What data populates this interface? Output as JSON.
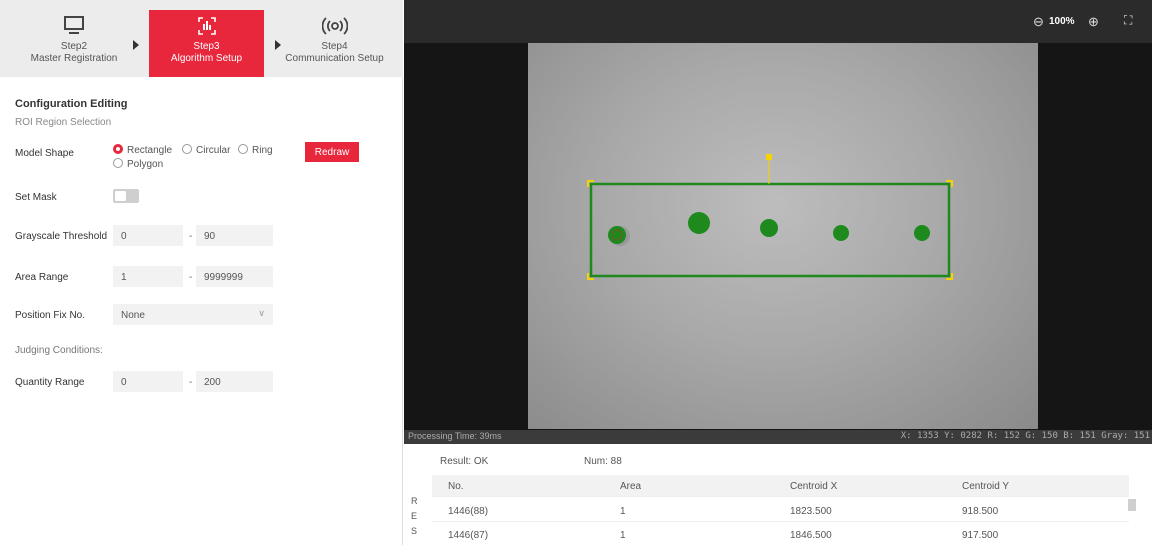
{
  "steps": [
    {
      "title": "Step2",
      "name": "Master Registration",
      "icon": "monitor-icon"
    },
    {
      "title": "Step3",
      "name": "Algorithm Setup",
      "icon": "algorithm-icon"
    },
    {
      "title": "Step4",
      "name": "Communication Setup",
      "icon": "broadcast-icon"
    }
  ],
  "config": {
    "title": "Configuration Editing",
    "roi_label": "ROI Region Selection",
    "model_shape_label": "Model Shape",
    "shapes": [
      "Rectangle",
      "Circular",
      "Ring",
      "Polygon"
    ],
    "selected_shape": "Rectangle",
    "redraw_label": "Redraw",
    "set_mask_label": "Set Mask",
    "set_mask_on": false,
    "grayscale_label": "Grayscale Threshold",
    "grayscale_min": "0",
    "grayscale_max": "90",
    "area_label": "Area Range",
    "area_min": "1",
    "area_max": "9999999",
    "position_fix_label": "Position Fix No.",
    "position_fix_value": "None",
    "judging_label": "Judging Conditions:",
    "quantity_label": "Quantity Range",
    "quantity_min": "0",
    "quantity_max": "200",
    "dash": "-"
  },
  "viewer": {
    "zoom_level": "100%",
    "processing_time": "Processing Time: 39ms",
    "coords": "X: 1353  Y: 0282  R: 152  G: 150  B: 151  Gray: 151",
    "roi_color": "#1e8a1e",
    "handle_color": "#f5d300"
  },
  "results": {
    "side_letters": [
      "R",
      "E",
      "S"
    ],
    "result_text": "Result: OK",
    "num_text": "Num: 88",
    "columns": [
      "No.",
      "Area",
      "Centroid X",
      "Centroid Y"
    ],
    "rows": [
      [
        "1446(88)",
        "1",
        "1823.500",
        "918.500"
      ],
      [
        "1446(87)",
        "1",
        "1846.500",
        "917.500"
      ]
    ]
  },
  "colors": {
    "accent": "#e8263c"
  }
}
